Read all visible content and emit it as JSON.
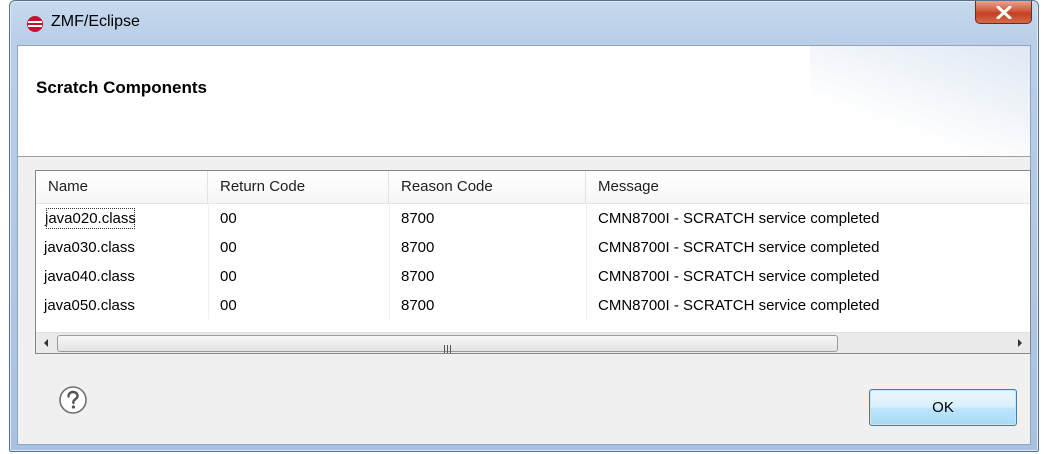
{
  "window": {
    "title": "ZMF/Eclipse",
    "close_glyph": "X"
  },
  "header": {
    "title": "Scratch Components"
  },
  "table": {
    "columns": [
      "Name",
      "Return Code",
      "Reason Code",
      "Message"
    ],
    "rows": [
      [
        "java020.class",
        "00",
        "8700",
        "CMN8700I - SCRATCH  service completed"
      ],
      [
        "java030.class",
        "00",
        "8700",
        "CMN8700I - SCRATCH  service completed"
      ],
      [
        "java040.class",
        "00",
        "8700",
        "CMN8700I - SCRATCH  service completed"
      ],
      [
        "java050.class",
        "00",
        "8700",
        "CMN8700I - SCRATCH  service completed"
      ]
    ],
    "scrollbar_grip": "III"
  },
  "footer": {
    "ok_label": "OK"
  },
  "icons": {
    "app": "eclipse-icon",
    "close": "close-icon",
    "help": "help-icon",
    "scroll_left": "scroll-left-arrow-icon",
    "scroll_right": "scroll-right-arrow-icon"
  },
  "colors": {
    "titlebar": "#b9cfe8",
    "close_button": "#c3401f",
    "ok_button": "#bee6fd",
    "app_icon": "#c8102e"
  }
}
